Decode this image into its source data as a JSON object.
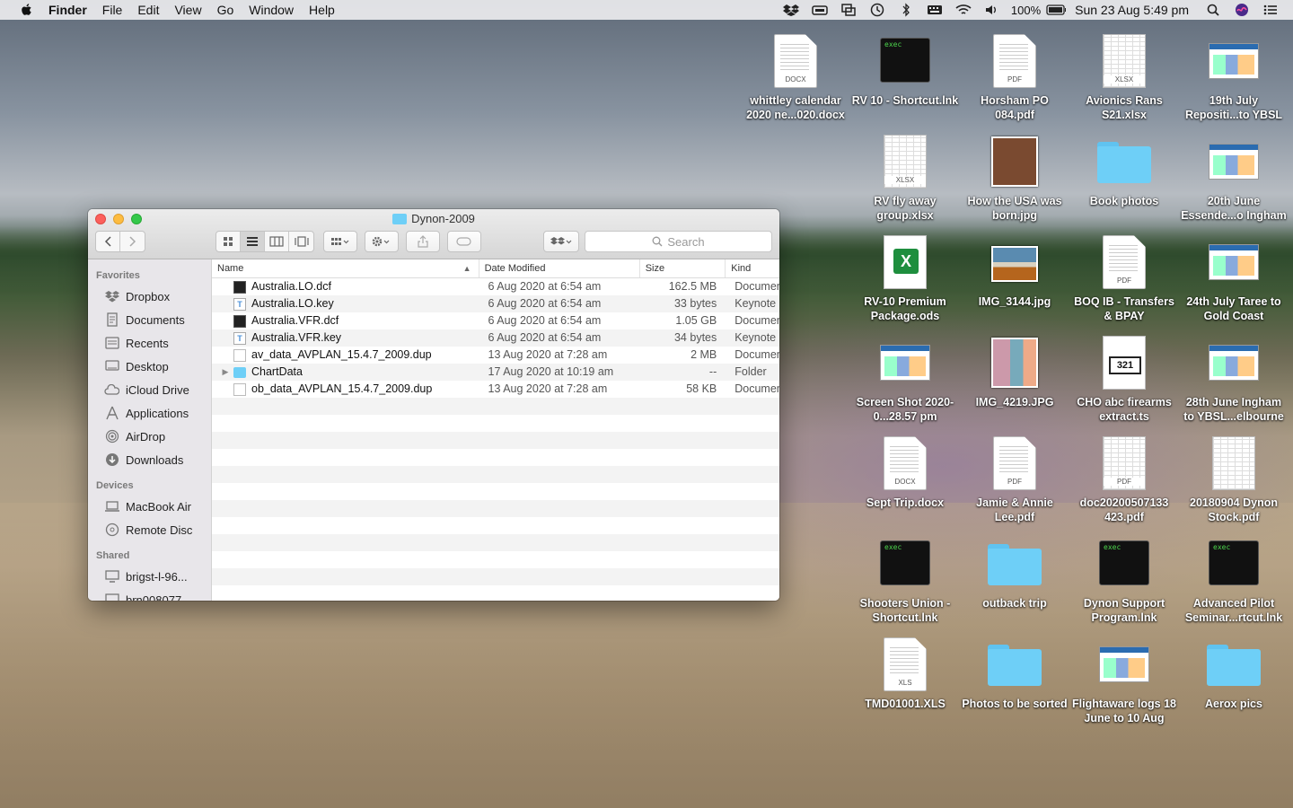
{
  "menubar": {
    "app": "Finder",
    "items": [
      "File",
      "Edit",
      "View",
      "Go",
      "Window",
      "Help"
    ],
    "battery": "100%",
    "datetime": "Sun 23 Aug  5:49 pm"
  },
  "desktop": [
    {
      "label": "whittley calendar 2020 ne...020.docx",
      "type": "doc",
      "tag": "DOCX"
    },
    {
      "label": "RV 10 - Shortcut.lnk",
      "type": "exec",
      "tag": "exec"
    },
    {
      "label": "Horsham PO 084.pdf",
      "type": "doc",
      "tag": "PDF"
    },
    {
      "label": "Avionics Rans S21.xlsx",
      "type": "sheet",
      "tag": "XLSX"
    },
    {
      "label": "19th July Repositi...to YBSL",
      "type": "thumb"
    },
    {
      "label": "RV fly away group.xlsx",
      "type": "sheet",
      "tag": "XLSX"
    },
    {
      "label": "How the USA was born.jpg",
      "type": "photo"
    },
    {
      "label": "Book photos",
      "type": "folder"
    },
    {
      "label": "20th June Essende...o Ingham",
      "type": "thumb"
    },
    {
      "label": "RV-10 Premium Package.ods",
      "type": "ods"
    },
    {
      "label": "IMG_3144.jpg",
      "type": "boat"
    },
    {
      "label": "BOQ IB - Transfers & BPAY",
      "type": "doc",
      "tag": "PDF"
    },
    {
      "label": "24th July Taree to Gold Coast",
      "type": "thumb"
    },
    {
      "label": "Screen Shot 2020-0...28.57 pm",
      "type": "thumb"
    },
    {
      "label": "IMG_4219.JPG",
      "type": "people"
    },
    {
      "label": "CHO abc firearms extract.ts",
      "type": "video",
      "tag": "321"
    },
    {
      "label": "28th June Ingham to YBSL...elbourne",
      "type": "thumb"
    },
    {
      "label": "Sept Trip.docx",
      "type": "doc",
      "tag": "DOCX"
    },
    {
      "label": "Jamie & Annie Lee.pdf",
      "type": "doc",
      "tag": "PDF"
    },
    {
      "label": "doc20200507133 423.pdf",
      "type": "sheet",
      "tag": "PDF"
    },
    {
      "label": "20180904 Dynon Stock.pdf",
      "type": "sheet",
      "tag": ""
    },
    {
      "label": "Shooters Union - Shortcut.lnk",
      "type": "exec",
      "tag": "exec"
    },
    {
      "label": "outback trip",
      "type": "folder"
    },
    {
      "label": "Dynon Support Program.lnk",
      "type": "exec",
      "tag": "exec"
    },
    {
      "label": "Advanced Pilot Seminar...rtcut.lnk",
      "type": "exec",
      "tag": "exec"
    },
    {
      "label": "TMD01001.XLS",
      "type": "doc",
      "tag": "XLS"
    },
    {
      "label": "Photos to be sorted",
      "type": "folder"
    },
    {
      "label": "Flightaware logs 18 June to 10 Aug",
      "type": "thumb"
    },
    {
      "label": "Aerox pics",
      "type": "folder"
    }
  ],
  "finder": {
    "title": "Dynon-2009",
    "search_placeholder": "Search",
    "sidebar": {
      "favorites_label": "Favorites",
      "favorites": [
        "Dropbox",
        "Documents",
        "Recents",
        "Desktop",
        "iCloud Drive",
        "Applications",
        "AirDrop",
        "Downloads"
      ],
      "devices_label": "Devices",
      "devices": [
        "MacBook Air",
        "Remote Disc"
      ],
      "shared_label": "Shared",
      "shared": [
        "brigst-l-96...",
        "brn008077..."
      ]
    },
    "columns": {
      "name": "Name",
      "date": "Date Modified",
      "size": "Size",
      "kind": "Kind"
    },
    "files": [
      {
        "name": "Australia.LO.dcf",
        "date": "6 Aug 2020 at 6:54 am",
        "size": "162.5 MB",
        "kind": "Document",
        "icon": "black"
      },
      {
        "name": "Australia.LO.key",
        "date": "6 Aug 2020 at 6:54 am",
        "size": "33 bytes",
        "kind": "Keynote",
        "icon": "key"
      },
      {
        "name": "Australia.VFR.dcf",
        "date": "6 Aug 2020 at 6:54 am",
        "size": "1.05 GB",
        "kind": "Document",
        "icon": "black"
      },
      {
        "name": "Australia.VFR.key",
        "date": "6 Aug 2020 at 6:54 am",
        "size": "34 bytes",
        "kind": "Keynote",
        "icon": "key"
      },
      {
        "name": "av_data_AVPLAN_15.4.7_2009.dup",
        "date": "13 Aug 2020 at 7:28 am",
        "size": "2 MB",
        "kind": "Document",
        "icon": "plain"
      },
      {
        "name": "ChartData",
        "date": "17 Aug 2020 at 10:19 am",
        "size": "--",
        "kind": "Folder",
        "icon": "fold"
      },
      {
        "name": "ob_data_AVPLAN_15.4.7_2009.dup",
        "date": "13 Aug 2020 at 7:28 am",
        "size": "58 KB",
        "kind": "Document",
        "icon": "plain"
      }
    ]
  }
}
